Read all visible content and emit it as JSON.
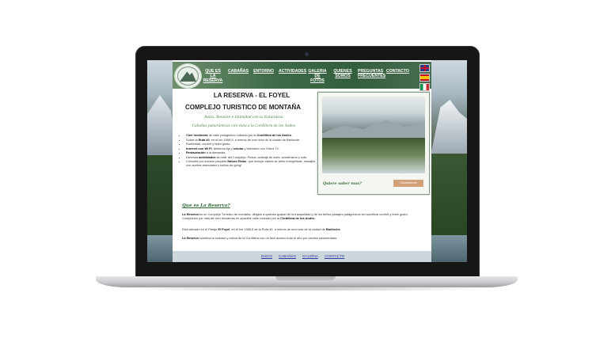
{
  "site": {
    "nav": [
      {
        "line1": "QUE ES",
        "line2": "LA RESERVA"
      },
      {
        "line1": "CABAÑAS",
        "line2": ""
      },
      {
        "line1": "ENTORNO",
        "line2": ""
      },
      {
        "line1": "ACTIVIDADES",
        "line2": ""
      },
      {
        "line1": "GALERIA",
        "line2": "DE FOTOS"
      },
      {
        "line1": "QUIENES",
        "line2": "SOMOS"
      },
      {
        "line1": "PREGUNTAS",
        "line2": "FRECUENTES"
      },
      {
        "line1": "CONTACTO",
        "line2": ""
      }
    ],
    "title1": "LA RESERVA - EL FOYEL",
    "title2": "COMPLEJO TURISTICO DE MONTAÑA",
    "tagline1": "Relax, Reunión e Intimidad con la Naturaleza",
    "tagline2": "Cabañas panorámicas con vista a la Cordillera de los Andes",
    "features": [
      {
        "b1": "Cien hectáreas",
        "t1": " de valle patagónico rodeado por la ",
        "b2": "Cordillera de los Andes",
        "t2": "."
      },
      {
        "b1": "",
        "t1": "Sobre la ",
        "b2": "Ruta 40",
        "t2": ", en el km 1958,5, a menos de una hora de la ciudad de Bariloche."
      },
      {
        "b1": "",
        "t1": "Rusticidad, confort y buen gusto.",
        "b2": "",
        "t2": ""
      },
      {
        "b1": "Internet con WI FI",
        "t1": ", telefonía fija y ",
        "b2": "celular",
        "t2": " y televisión con Direct TV."
      },
      {
        "b1": "Restauración",
        "t1": " a la demanda.",
        "b2": "",
        "t2": ""
      },
      {
        "b1": "",
        "t1": "Diversas ",
        "b2": "actividades",
        "t2": " sin salir del Complejo: Pesca, avistaje de aves, senderismo y más."
      },
      {
        "b1": "",
        "t1": "Consulte por nuestro paquete ",
        "b2": "Naturo Relax",
        "t2": ", que incluye clases de artes energéticas, masajes con aceites esenciales y baños de gong!"
      }
    ],
    "card": {
      "question": "Quiere saber mas?",
      "button": "Contactenos"
    },
    "section_title": "Que es La Reserva?",
    "p1": {
      "a": "La Reserva",
      "b": " es un Complejo Turístico de montaña, dirigido a quienes gustan de la tranquilidad y de los bellos paisajes patagónicos sin sacrificar confort y buen gusto. Compuesto por más de cien hectáreas en apacible valle rodeado por la ",
      "c": "Cordillera de los Andes",
      "d": "."
    },
    "p2": {
      "a": "Está ubicado en el Paraje ",
      "b": "El Foyel",
      "c": ", en el km 1958,5 de la Ruta 40, a menos de una hora de la ciudad de ",
      "d": "Bariloche",
      "e": "."
    },
    "p3": {
      "a": "La Reserva",
      "b": " combina la soledad y calma de la Cordillera con un fácil acceso todo el año por camino pavimentado."
    },
    "footer": [
      "INICIO",
      "CABAÑAS",
      "GALERIA",
      "CONTACTO"
    ]
  },
  "icons": {
    "logo": "la-reserva-logo",
    "flags": [
      "uk-flag-icon",
      "spain-flag-icon",
      "italy-flag-icon"
    ]
  },
  "colors": {
    "header_green": "#3f6a47",
    "tagline_green": "#4f7c4b",
    "button": "#d4a07a",
    "footer_link": "#2b3ca8"
  }
}
